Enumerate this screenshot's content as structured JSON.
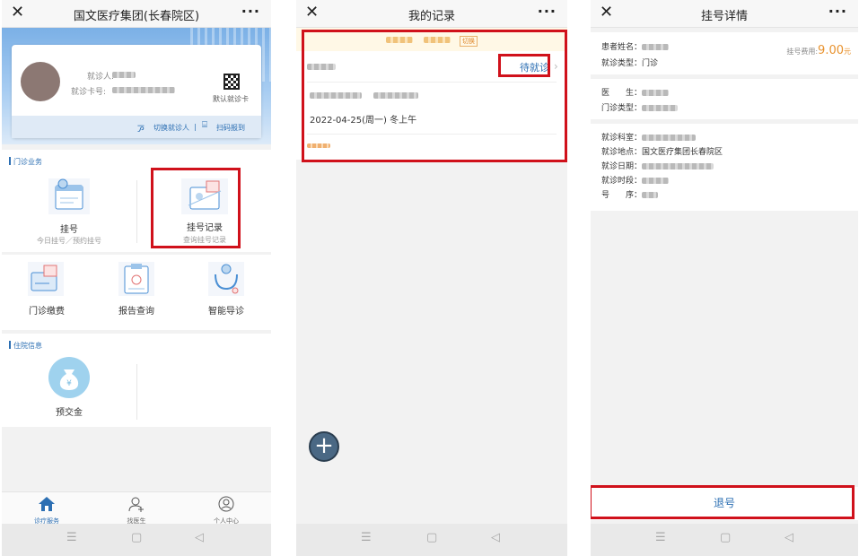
{
  "colors": {
    "accent": "#2c6fb3",
    "orange": "#e8922e",
    "highlight_red": "#d0111b"
  },
  "screens": {
    "home": {
      "title": "国文医疗集团(长春院区)",
      "patient_label": "就诊人:",
      "card_no_label": "就诊卡号:",
      "default_card_label": "默认就诊卡",
      "switch_patient": "切换就诊人",
      "separator": "|",
      "scan_report": "扫码报到",
      "outpatient_section": "门诊业务",
      "inpatient_section": "住院信息",
      "services": [
        {
          "label": "挂号",
          "sub": "今日挂号／预约挂号",
          "icon": "calendar-doctor-icon"
        },
        {
          "label": "挂号记录",
          "sub": "查询挂号记录",
          "icon": "record-list-icon"
        },
        {
          "label": "门诊缴费",
          "icon": "payment-card-icon"
        },
        {
          "label": "报告查询",
          "icon": "report-clipboard-icon"
        },
        {
          "label": "智能导诊",
          "icon": "stethoscope-icon"
        }
      ],
      "inpatient_services": [
        {
          "label": "预交金",
          "icon": "money-bag-icon"
        }
      ],
      "tabs": [
        {
          "label": "诊疗服务",
          "icon": "home-icon",
          "active": true
        },
        {
          "label": "找医生",
          "icon": "add-doctor-icon",
          "active": false
        },
        {
          "label": "个人中心",
          "icon": "user-circle-icon",
          "active": false
        }
      ]
    },
    "records": {
      "title": "我的记录",
      "switch_label": "切换",
      "record": {
        "status": "待就诊",
        "date": "2022-04-25(周一) 冬上午"
      }
    },
    "detail": {
      "title": "挂号详情",
      "fee_label": "挂号费用:",
      "fee_value": "9.00",
      "fee_unit": "元",
      "patient_name_label": "患者姓名：",
      "visit_type_label": "就诊类型：",
      "visit_type_value": "门诊",
      "doctor_label": "医　　生：",
      "clinic_type_label": "门诊类型：",
      "dept_label": "就诊科室：",
      "location_label": "就诊地点：",
      "location_value": "国文医疗集团长春院区",
      "date_label": "就诊日期：",
      "period_label": "就诊时段：",
      "seq_label": "号　　序：",
      "cancel_button": "退号"
    }
  },
  "system_nav": {
    "menu": "☰",
    "home": "▢",
    "back": "◁"
  },
  "window_controls": {
    "close": "✕",
    "more": "···"
  }
}
